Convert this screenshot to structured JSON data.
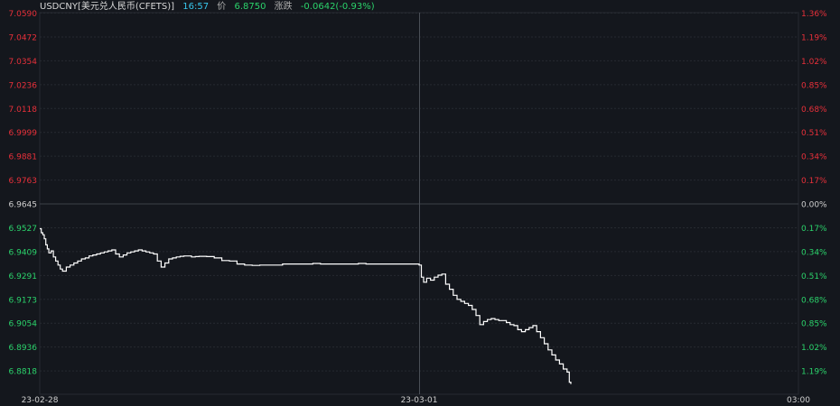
{
  "header": {
    "symbol": "USDCNY[美元兑人民币(CFETS)]",
    "time": "16:57",
    "price_label": "价",
    "price": "6.8750",
    "change_label": "涨跌",
    "change": "-0.0642(-0.93%)"
  },
  "colors": {
    "background": "#14171d",
    "grid": "#262a31",
    "up": "#e8303a",
    "down": "#2bd36b",
    "neutral": "#d0d0d0",
    "line": "#ffffff",
    "time_text": "#38c8ee"
  },
  "chart_data": {
    "type": "line",
    "reference_price": 6.9645,
    "ylim": [
      6.87,
      7.059
    ],
    "y_ticks_left": [
      "7.0590",
      "7.0472",
      "7.0354",
      "7.0236",
      "7.0118",
      "6.9999",
      "6.9881",
      "6.9763",
      "6.9645",
      "6.9527",
      "6.9409",
      "6.9291",
      "6.9173",
      "6.9054",
      "6.8936",
      "6.8818"
    ],
    "y_ticks_right": [
      "1.36%",
      "1.19%",
      "1.02%",
      "0.85%",
      "0.68%",
      "0.51%",
      "0.34%",
      "0.17%",
      "0.00%",
      "0.17%",
      "0.34%",
      "0.51%",
      "0.68%",
      "0.85%",
      "1.02%",
      "1.19%"
    ],
    "x_ticks": [
      "23-02-28",
      "23-03-01",
      "03:00"
    ],
    "x_tick_positions": [
      0,
      0.5,
      1
    ],
    "grid": true,
    "series": [
      {
        "x": [
          0,
          0.002,
          0.004,
          0.006,
          0.008,
          0.01,
          0.012,
          0.015,
          0.018,
          0.021,
          0.024,
          0.027,
          0.03,
          0.035,
          0.04,
          0.045,
          0.05,
          0.055,
          0.06,
          0.065,
          0.07,
          0.075,
          0.08,
          0.085,
          0.09,
          0.095,
          0.1,
          0.105,
          0.11,
          0.115,
          0.12,
          0.125,
          0.13,
          0.135,
          0.14,
          0.145,
          0.15,
          0.155,
          0.16,
          0.165,
          0.17,
          0.175,
          0.18,
          0.185,
          0.19,
          0.195,
          0.2,
          0.205,
          0.21,
          0.215,
          0.22,
          0.225,
          0.23,
          0.24,
          0.25,
          0.26,
          0.27,
          0.28,
          0.29,
          0.3,
          0.31,
          0.32,
          0.33,
          0.34,
          0.35,
          0.36,
          0.37,
          0.38,
          0.39,
          0.4,
          0.41,
          0.42,
          0.43,
          0.44,
          0.45,
          0.46,
          0.47,
          0.48,
          0.49,
          0.5,
          0.503,
          0.506,
          0.51,
          0.515,
          0.52,
          0.525,
          0.53,
          0.535,
          0.54,
          0.545,
          0.55,
          0.555,
          0.56,
          0.565,
          0.57,
          0.575,
          0.58,
          0.585,
          0.59,
          0.595,
          0.6,
          0.605,
          0.61,
          0.615,
          0.62,
          0.625,
          0.63,
          0.635,
          0.64,
          0.645,
          0.65,
          0.655,
          0.66,
          0.665,
          0.67,
          0.675,
          0.68,
          0.685,
          0.69,
          0.695,
          0.698,
          0.7
        ],
        "y": [
          6.952,
          6.95,
          6.949,
          6.947,
          6.944,
          6.942,
          6.94,
          6.941,
          6.938,
          6.936,
          6.934,
          6.932,
          6.931,
          6.933,
          6.934,
          6.935,
          6.936,
          6.937,
          6.9375,
          6.9385,
          6.939,
          6.9395,
          6.94,
          6.9405,
          6.941,
          6.9415,
          6.9395,
          6.938,
          6.939,
          6.94,
          6.9405,
          6.941,
          6.9415,
          6.941,
          6.9405,
          6.94,
          6.9395,
          6.936,
          6.933,
          6.935,
          6.937,
          6.9375,
          6.938,
          6.9383,
          6.9385,
          6.9385,
          6.938,
          6.9382,
          6.9383,
          6.9383,
          6.9382,
          6.9382,
          6.9375,
          6.9362,
          6.936,
          6.9345,
          6.934,
          6.9338,
          6.934,
          6.934,
          6.934,
          6.9345,
          6.9345,
          6.9345,
          6.9345,
          6.9348,
          6.9345,
          6.9345,
          6.9345,
          6.9345,
          6.9345,
          6.9348,
          6.9345,
          6.9345,
          6.9345,
          6.9345,
          6.9345,
          6.9345,
          6.9345,
          6.934,
          6.928,
          6.9255,
          6.9275,
          6.9265,
          6.928,
          6.929,
          6.9295,
          6.9245,
          6.922,
          6.919,
          6.917,
          6.916,
          6.915,
          6.914,
          6.912,
          6.909,
          6.9045,
          6.906,
          6.907,
          6.9075,
          6.907,
          6.9065,
          6.9065,
          6.9055,
          6.9045,
          6.904,
          6.902,
          6.901,
          6.902,
          6.903,
          6.904,
          6.901,
          6.898,
          6.895,
          6.892,
          6.8895,
          6.887,
          6.885,
          6.8825,
          6.881,
          6.876,
          6.875
        ]
      }
    ]
  }
}
